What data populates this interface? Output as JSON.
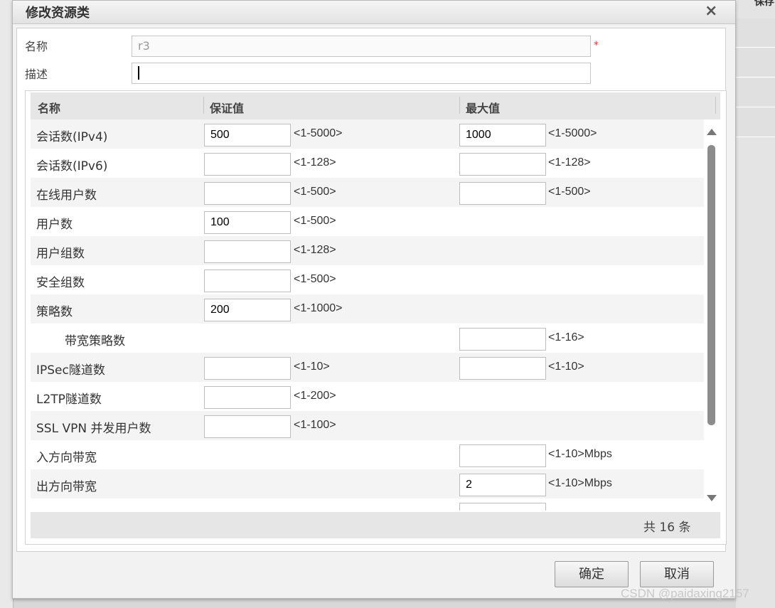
{
  "dialog": {
    "title": "修改资源类",
    "close_icon": "×"
  },
  "form": {
    "name_label": "名称",
    "name_value": "r3",
    "required_mark": "*",
    "desc_label": "描述",
    "desc_value": ""
  },
  "grid": {
    "headers": [
      "名称",
      "保证值",
      "最大值"
    ],
    "rows": [
      {
        "name": "会话数(IPv4)",
        "guarantee": "500",
        "guarantee_range": "<1-5000>",
        "max": "1000",
        "max_range": "<1-5000>"
      },
      {
        "name": "会话数(IPv6)",
        "guarantee": "",
        "guarantee_range": "<1-128>",
        "max": "",
        "max_range": "<1-128>"
      },
      {
        "name": "在线用户数",
        "guarantee": "",
        "guarantee_range": "<1-500>",
        "max": "",
        "max_range": "<1-500>"
      },
      {
        "name": "用户数",
        "guarantee": "100",
        "guarantee_range": "<1-500>"
      },
      {
        "name": "用户组数",
        "guarantee": "",
        "guarantee_range": "<1-128>"
      },
      {
        "name": "安全组数",
        "guarantee": "",
        "guarantee_range": "<1-500>"
      },
      {
        "name": "策略数",
        "guarantee": "200",
        "guarantee_range": "<1-1000>"
      },
      {
        "name": "带宽策略数",
        "max": "",
        "max_range": "<1-16>"
      },
      {
        "name": "IPSec隧道数",
        "guarantee": "",
        "guarantee_range": "<1-10>",
        "max": "",
        "max_range": "<1-10>"
      },
      {
        "name": "L2TP隧道数",
        "guarantee": "",
        "guarantee_range": "<1-200>"
      },
      {
        "name": "SSL VPN 并发用户数",
        "guarantee": "",
        "guarantee_range": "<1-100>"
      },
      {
        "name": "入方向带宽",
        "max": "",
        "max_range": "<1-10>Mbps"
      },
      {
        "name": "出方向带宽",
        "max": "2",
        "max_range": "<1-10>Mbps"
      }
    ],
    "footer": "共 16 条"
  },
  "buttons": {
    "ok": "确定",
    "cancel": "取消"
  },
  "background": {
    "right_clip_label": "保存"
  },
  "watermark": "CSDN @paidaxing2157"
}
